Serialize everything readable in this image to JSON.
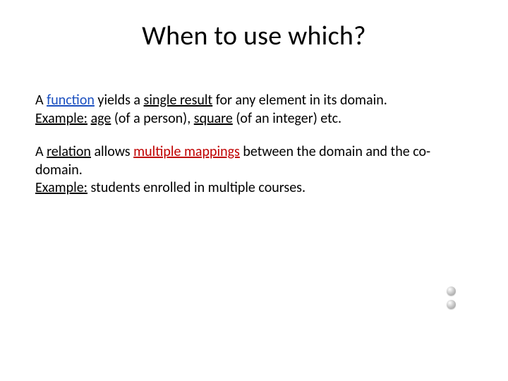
{
  "title": "When to use which?",
  "para1": {
    "p1": "A ",
    "function": "function",
    "p2": " yields a ",
    "single_result": "single result",
    "p3": " for any element in its domain.",
    "example_label": "Example:",
    "p4": " ",
    "age": "age",
    "p5": " (of a person), ",
    "square": "square",
    "p6": " (of an integer) etc."
  },
  "para2": {
    "p1": "A ",
    "relation": "relation",
    "p2": " allows ",
    "multiple_mappings": "multiple mappings",
    "p3": " between the domain and the co-domain.",
    "example_label": "Example:",
    "p4": " students enrolled in multiple courses."
  }
}
